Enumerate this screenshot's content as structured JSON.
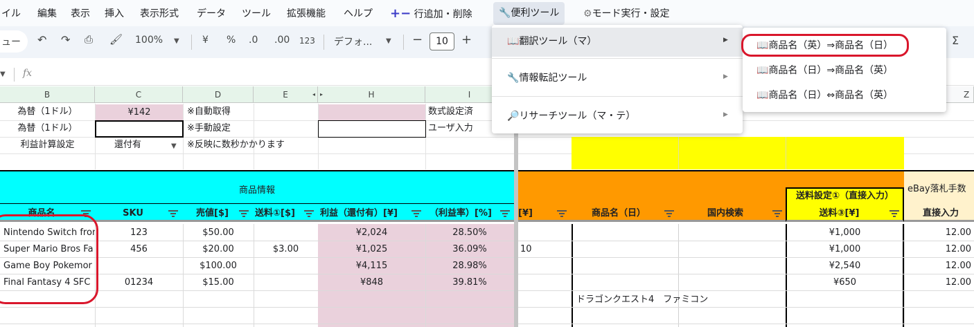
{
  "menubar": {
    "items": [
      "イル",
      "編集",
      "表示",
      "挿入",
      "表示形式",
      "データ",
      "ツール",
      "拡張機能",
      "ヘルプ"
    ],
    "addon_add": "行追加・削除",
    "addon_tools": "便利ツール",
    "addon_mode": "モード実行・設定"
  },
  "toolbar": {
    "search_menu": "ュー",
    "zoom": "100%",
    "currency": "¥",
    "percent": "%",
    "dec_decrease": ".0",
    "dec_increase": ".00",
    "format_123": "123",
    "font": "デフォ...",
    "font_size": "10",
    "sigma": "Σ"
  },
  "formula": {
    "fx": "fx"
  },
  "columns": [
    "B",
    "C",
    "D",
    "E",
    "H",
    "I",
    "Z"
  ],
  "rows_top": {
    "r1": {
      "b": "為替（1ドル）",
      "c": "¥142",
      "d": "※自動取得",
      "i": "数式設定済"
    },
    "r2": {
      "b": "為替（1ドル）",
      "d": "※手動設定",
      "i": "ユーザ入力"
    },
    "r3": {
      "b": "利益計算設定",
      "c": "還付有",
      "d": "※反映に数秒かかります"
    }
  },
  "headers": {
    "section_product": "商品情報",
    "shipping_setting": "送料設定①（直接入力）",
    "ebay_fee": "eBay落札手数",
    "product_name": "商品名",
    "sku": "SKU",
    "price": "売値[$]",
    "shipping": "送料①[$]",
    "profit": "利益（還付有）[¥]",
    "profit_rate": "（利益率）[%]",
    "yen_col": "[¥]",
    "product_name_jp": "商品名（日）",
    "domestic_search": "国内検索",
    "shipping3": "送料③[¥]",
    "direct_input": "直接入力"
  },
  "table": [
    {
      "name": "Nintendo Switch fron",
      "sku": "123",
      "price": "$50.00",
      "ship": "",
      "profit": "¥2,024",
      "rate": "28.50%",
      "yen": "",
      "jp": "",
      "ship3": "¥1,000",
      "direct": "12.00"
    },
    {
      "name": "Super Mario Bros Fa",
      "sku": "456",
      "price": "$20.00",
      "ship": "$3.00",
      "profit": "¥1,025",
      "rate": "36.09%",
      "yen": "10",
      "jp": "",
      "ship3": "¥1,000",
      "direct": "12.00"
    },
    {
      "name": "Game Boy Pokemor",
      "sku": "",
      "price": "$100.00",
      "ship": "",
      "profit": "¥4,115",
      "rate": "28.98%",
      "yen": "",
      "jp": "",
      "ship3": "¥2,540",
      "direct": "12.00"
    },
    {
      "name": "Final Fantasy 4 SFC",
      "sku": "01234",
      "price": "$15.00",
      "ship": "",
      "profit": "¥848",
      "rate": "39.81%",
      "yen": "",
      "jp": "",
      "ship3": "¥650",
      "direct": "12.00"
    }
  ],
  "extra_row": {
    "jp": "ドラゴンクエスト4　ファミコン"
  },
  "menus": {
    "tools": {
      "translate": "翻訳ツール（マ）",
      "transfer": "情報転記ツール",
      "research": "リサーチツール（マ・テ）"
    },
    "translate_sub": {
      "en_to_jp": "商品名（英）⇒商品名（日）",
      "jp_to_en": "商品名（日）⇒商品名（英）",
      "jp_swap_en": "商品名（日）⇔商品名（英）"
    }
  },
  "colors": {
    "cyan": "#00ffff",
    "orange": "#ff9900",
    "yellow": "#ffff00",
    "pink": "#ead1dc",
    "highlight_red": "#d9162b",
    "green_header": "#e6f4ea"
  }
}
